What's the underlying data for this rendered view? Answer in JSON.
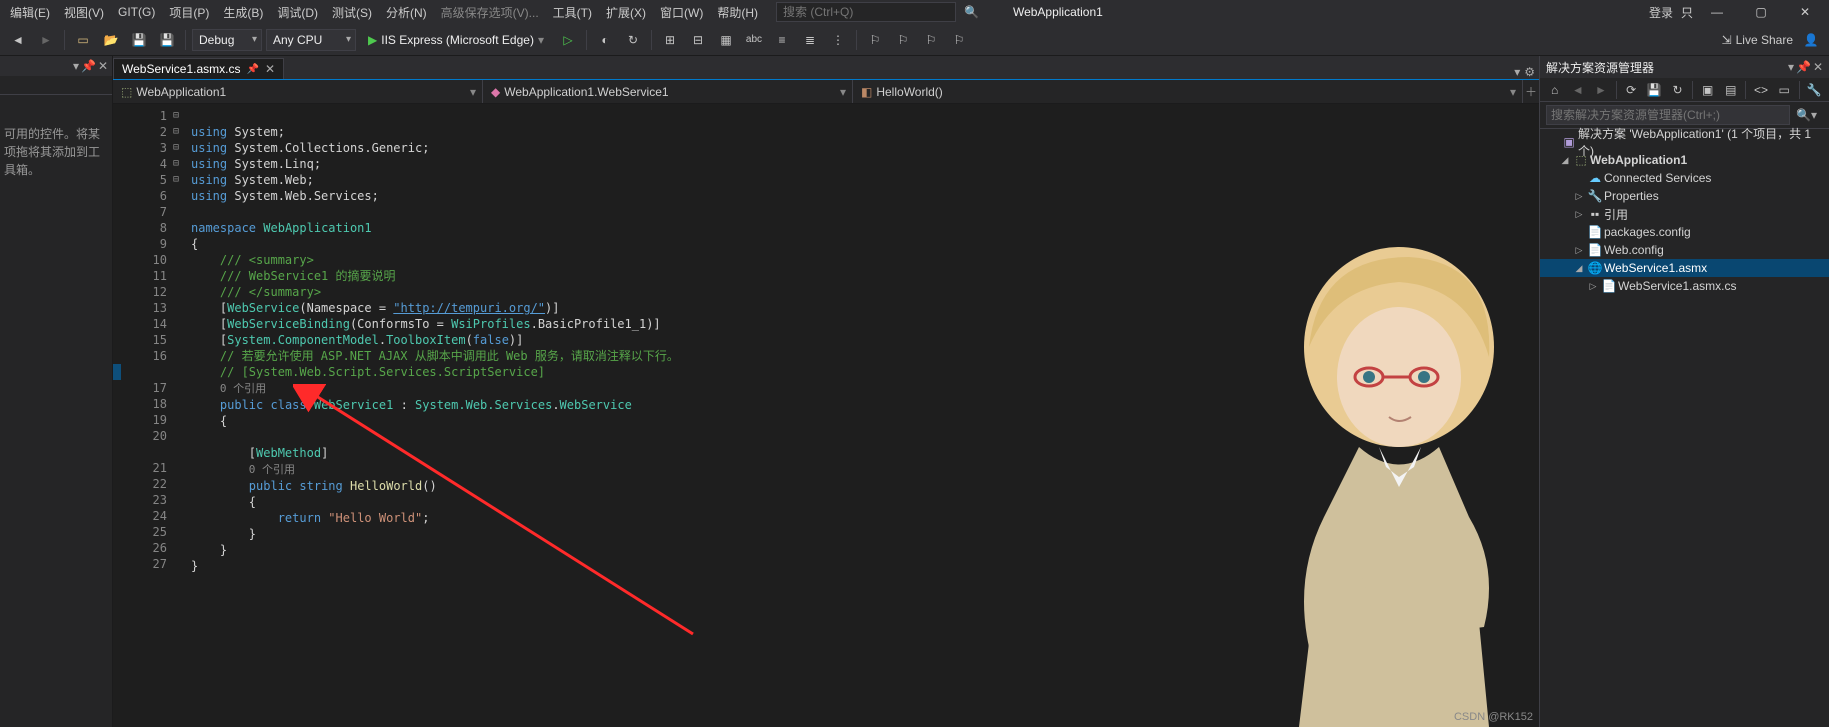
{
  "menu": {
    "items": [
      "编辑(E)",
      "视图(V)",
      "GIT(G)",
      "项目(P)",
      "生成(B)",
      "调试(D)",
      "测试(S)",
      "分析(N)",
      "高级保存选项(V)...",
      "工具(T)",
      "扩展(X)",
      "窗口(W)",
      "帮助(H)"
    ],
    "search_placeholder": "搜索 (Ctrl+Q)",
    "app_title": "WebApplication1",
    "login": "登录",
    "user": "只"
  },
  "toolbar": {
    "config": "Debug",
    "platform": "Any CPU",
    "run": "IIS Express (Microsoft Edge)",
    "liveshare": "Live Share"
  },
  "tab": {
    "filename": "WebService1.asmx.cs"
  },
  "context": {
    "project": "WebApplication1",
    "class": "WebApplication1.WebService1",
    "method": "HelloWorld()"
  },
  "toolbox": {
    "tip": "可用的控件。将某项拖将其添加到工具箱。"
  },
  "code": {
    "lines": [
      1,
      2,
      3,
      4,
      5,
      6,
      7,
      8,
      9,
      10,
      11,
      12,
      13,
      14,
      15,
      16,
      17,
      18,
      19,
      20,
      21,
      22,
      23,
      24,
      25,
      26,
      27
    ],
    "l1": "using System;",
    "l2": "using System.Collections.Generic;",
    "l3": "using System.Linq;",
    "l4": "using System.Web;",
    "l5": "using System.Web.Services;",
    "ns": "namespace WebApplication1",
    "sum1": "/// <summary>",
    "sum2": "/// WebService1 的摘要说明",
    "sum3": "/// </summary>",
    "attr1a": "[WebService(Namespace = ",
    "attr1url": "\"http://tempuri.org/\"",
    "attr1b": ")]",
    "attr2": "[WebServiceBinding(ConformsTo = WsiProfiles.BasicProfile1_1)]",
    "attr3": "[System.ComponentModel.ToolboxItem(false)]",
    "c1": "// 若要允许使用 ASP.NET AJAX 从脚本中调用此 Web 服务，请取消注释以下行。",
    "c2": "// [System.Web.Script.Services.ScriptService]",
    "codelens0": "0 个引用",
    "classline": "public class WebService1 : System.Web.Services.WebService",
    "webmethod": "[WebMethod]",
    "codelens1": "0 个引用",
    "methodline": "public string HelloWorld()",
    "ret": "return \"Hello World\";"
  },
  "solution": {
    "title": "解决方案资源管理器",
    "search_placeholder": "搜索解决方案资源管理器(Ctrl+;)",
    "root": "解决方案 'WebApplication1' (1 个项目，共 1 个)",
    "project": "WebApplication1",
    "items": {
      "connected": "Connected Services",
      "props": "Properties",
      "refs": "引用",
      "pkg": "packages.config",
      "webcfg": "Web.config",
      "asmx": "WebService1.asmx",
      "cs": "WebService1.asmx.cs"
    }
  },
  "watermark": "CSDN @RK152"
}
